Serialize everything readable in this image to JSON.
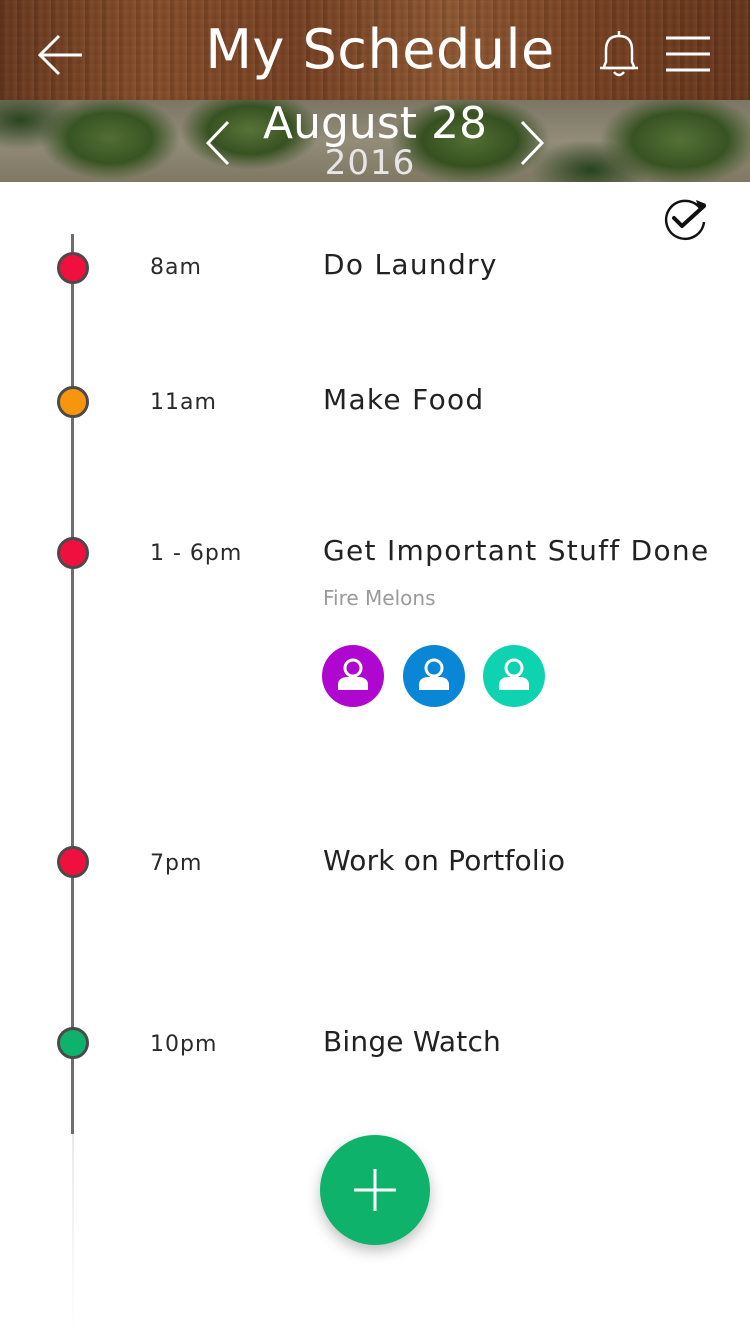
{
  "header": {
    "title": "My Schedule",
    "back_icon": "arrow-left-icon",
    "bell_icon": "bell-icon",
    "menu_icon": "hamburger-menu-icon"
  },
  "date_nav": {
    "date": "August 28",
    "year": "2016",
    "prev_icon": "chevron-left-icon",
    "next_icon": "chevron-right-icon"
  },
  "sync_icon": "refresh-check-icon",
  "events": [
    {
      "time": "8am",
      "title": "Do Laundry",
      "color": "#f0103f"
    },
    {
      "time": "11am",
      "title": "Make Food",
      "color": "#f8950f"
    },
    {
      "time": "1 - 6pm",
      "title": "Get Important Stuff Done",
      "subtitle": "Fire Melons",
      "color": "#f0103f",
      "attendees": [
        {
          "icon": "user-icon",
          "color": "#b007d0"
        },
        {
          "icon": "user-icon",
          "color": "#0a86d6"
        },
        {
          "icon": "user-icon",
          "color": "#0fd3b0"
        }
      ]
    },
    {
      "time": "7pm",
      "title": "Work on Portfolio",
      "color": "#f0103f"
    },
    {
      "time": "10pm",
      "title": "Binge Watch",
      "color": "#0fb26a"
    }
  ],
  "fab": {
    "icon": "plus-icon",
    "color": "#0fb26a"
  }
}
